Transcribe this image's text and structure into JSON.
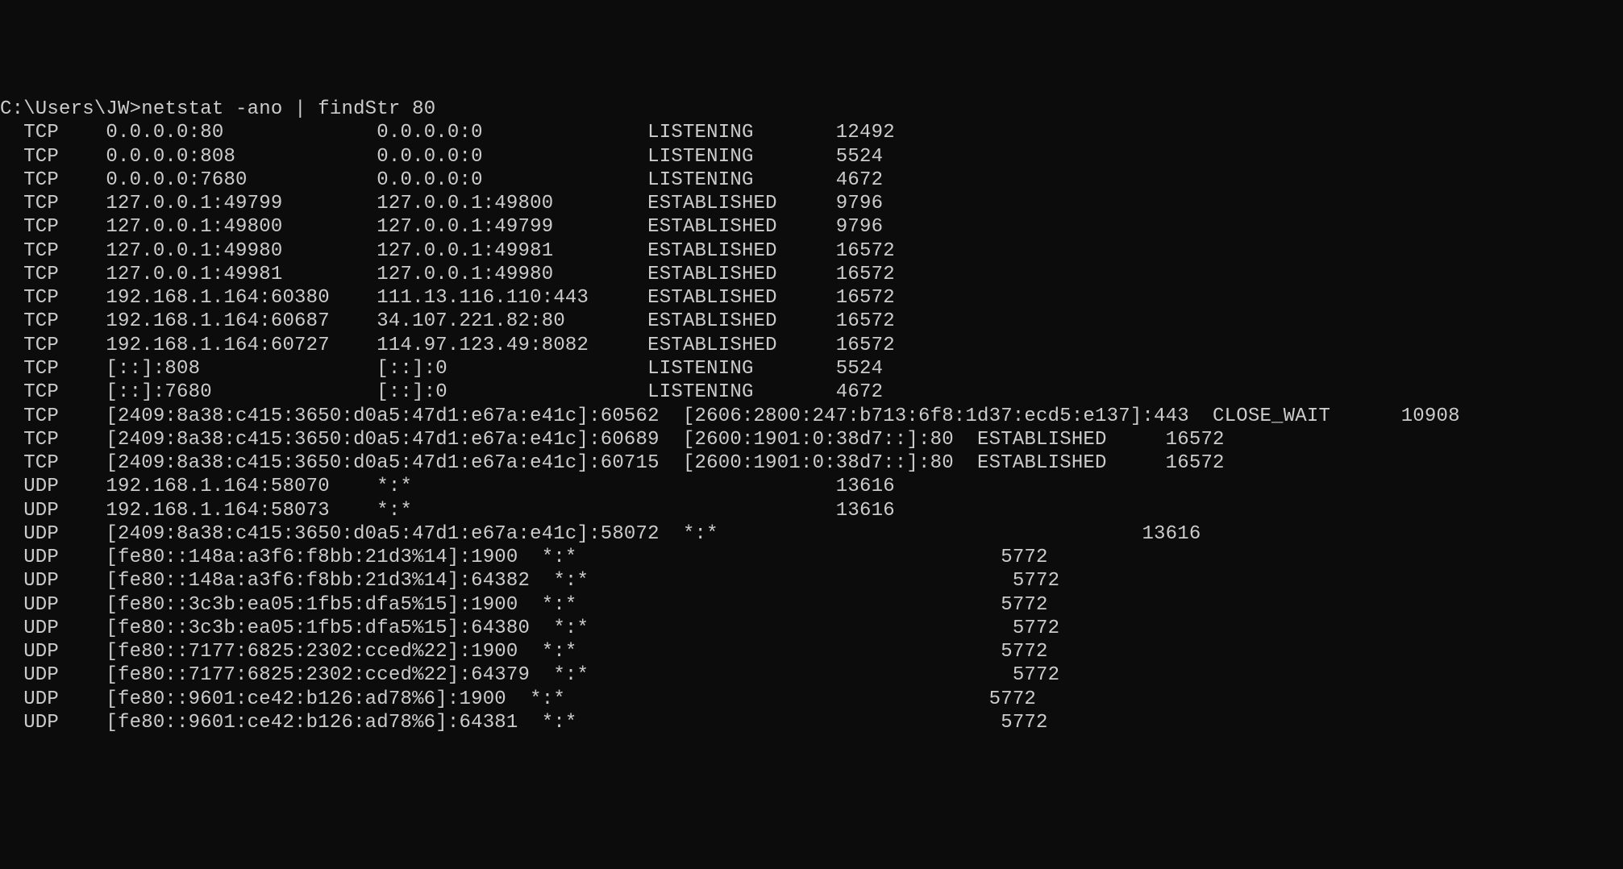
{
  "prompt": "C:\\Users\\JW>",
  "command": "netstat -ano | findStr 80",
  "rows": [
    {
      "proto": "TCP",
      "local": "0.0.0.0:80",
      "foreign": "0.0.0.0:0",
      "state": "LISTENING",
      "pid": "12492"
    },
    {
      "proto": "TCP",
      "local": "0.0.0.0:808",
      "foreign": "0.0.0.0:0",
      "state": "LISTENING",
      "pid": "5524"
    },
    {
      "proto": "TCP",
      "local": "0.0.0.0:7680",
      "foreign": "0.0.0.0:0",
      "state": "LISTENING",
      "pid": "4672"
    },
    {
      "proto": "TCP",
      "local": "127.0.0.1:49799",
      "foreign": "127.0.0.1:49800",
      "state": "ESTABLISHED",
      "pid": "9796"
    },
    {
      "proto": "TCP",
      "local": "127.0.0.1:49800",
      "foreign": "127.0.0.1:49799",
      "state": "ESTABLISHED",
      "pid": "9796"
    },
    {
      "proto": "TCP",
      "local": "127.0.0.1:49980",
      "foreign": "127.0.0.1:49981",
      "state": "ESTABLISHED",
      "pid": "16572"
    },
    {
      "proto": "TCP",
      "local": "127.0.0.1:49981",
      "foreign": "127.0.0.1:49980",
      "state": "ESTABLISHED",
      "pid": "16572"
    },
    {
      "proto": "TCP",
      "local": "192.168.1.164:60380",
      "foreign": "111.13.116.110:443",
      "state": "ESTABLISHED",
      "pid": "16572"
    },
    {
      "proto": "TCP",
      "local": "192.168.1.164:60687",
      "foreign": "34.107.221.82:80",
      "state": "ESTABLISHED",
      "pid": "16572"
    },
    {
      "proto": "TCP",
      "local": "192.168.1.164:60727",
      "foreign": "114.97.123.49:8082",
      "state": "ESTABLISHED",
      "pid": "16572"
    },
    {
      "proto": "TCP",
      "local": "[::]:808",
      "foreign": "[::]:0",
      "state": "LISTENING",
      "pid": "5524"
    },
    {
      "proto": "TCP",
      "local": "[::]:7680",
      "foreign": "[::]:0",
      "state": "LISTENING",
      "pid": "4672"
    },
    {
      "proto": "TCP",
      "local": "[2409:8a38:c415:3650:d0a5:47d1:e67a:e41c]:60562",
      "foreign": "[2606:2800:247:b713:6f8:1d37:ecd5:e137]:443",
      "state": "CLOSE_WAIT",
      "pid": "10908"
    },
    {
      "proto": "TCP",
      "local": "[2409:8a38:c415:3650:d0a5:47d1:e67a:e41c]:60689",
      "foreign": "[2600:1901:0:38d7::]:80",
      "state": "ESTABLISHED",
      "pid": "16572"
    },
    {
      "proto": "TCP",
      "local": "[2409:8a38:c415:3650:d0a5:47d1:e67a:e41c]:60715",
      "foreign": "[2600:1901:0:38d7::]:80",
      "state": "ESTABLISHED",
      "pid": "16572"
    },
    {
      "proto": "UDP",
      "local": "192.168.1.164:58070",
      "foreign": "*:*",
      "state": "",
      "pid": "13616"
    },
    {
      "proto": "UDP",
      "local": "192.168.1.164:58073",
      "foreign": "*:*",
      "state": "",
      "pid": "13616"
    },
    {
      "proto": "UDP",
      "local": "[2409:8a38:c415:3650:d0a5:47d1:e67a:e41c]:58072",
      "foreign": "*:*",
      "state": "",
      "pid": "13616"
    },
    {
      "proto": "UDP",
      "local": "[fe80::148a:a3f6:f8bb:21d3%14]:1900",
      "foreign": "*:*",
      "state": "",
      "pid": "5772"
    },
    {
      "proto": "UDP",
      "local": "[fe80::148a:a3f6:f8bb:21d3%14]:64382",
      "foreign": "*:*",
      "state": "",
      "pid": "5772"
    },
    {
      "proto": "UDP",
      "local": "[fe80::3c3b:ea05:1fb5:dfa5%15]:1900",
      "foreign": "*:*",
      "state": "",
      "pid": "5772"
    },
    {
      "proto": "UDP",
      "local": "[fe80::3c3b:ea05:1fb5:dfa5%15]:64380",
      "foreign": "*:*",
      "state": "",
      "pid": "5772"
    },
    {
      "proto": "UDP",
      "local": "[fe80::7177:6825:2302:cced%22]:1900",
      "foreign": "*:*",
      "state": "",
      "pid": "5772"
    },
    {
      "proto": "UDP",
      "local": "[fe80::7177:6825:2302:cced%22]:64379",
      "foreign": "*:*",
      "state": "",
      "pid": "5772"
    },
    {
      "proto": "UDP",
      "local": "[fe80::9601:ce42:b126:ad78%6]:1900",
      "foreign": "*:*",
      "state": "",
      "pid": "5772"
    },
    {
      "proto": "UDP",
      "local": "[fe80::9601:ce42:b126:ad78%6]:64381",
      "foreign": "*:*",
      "state": "",
      "pid": "5772"
    }
  ]
}
